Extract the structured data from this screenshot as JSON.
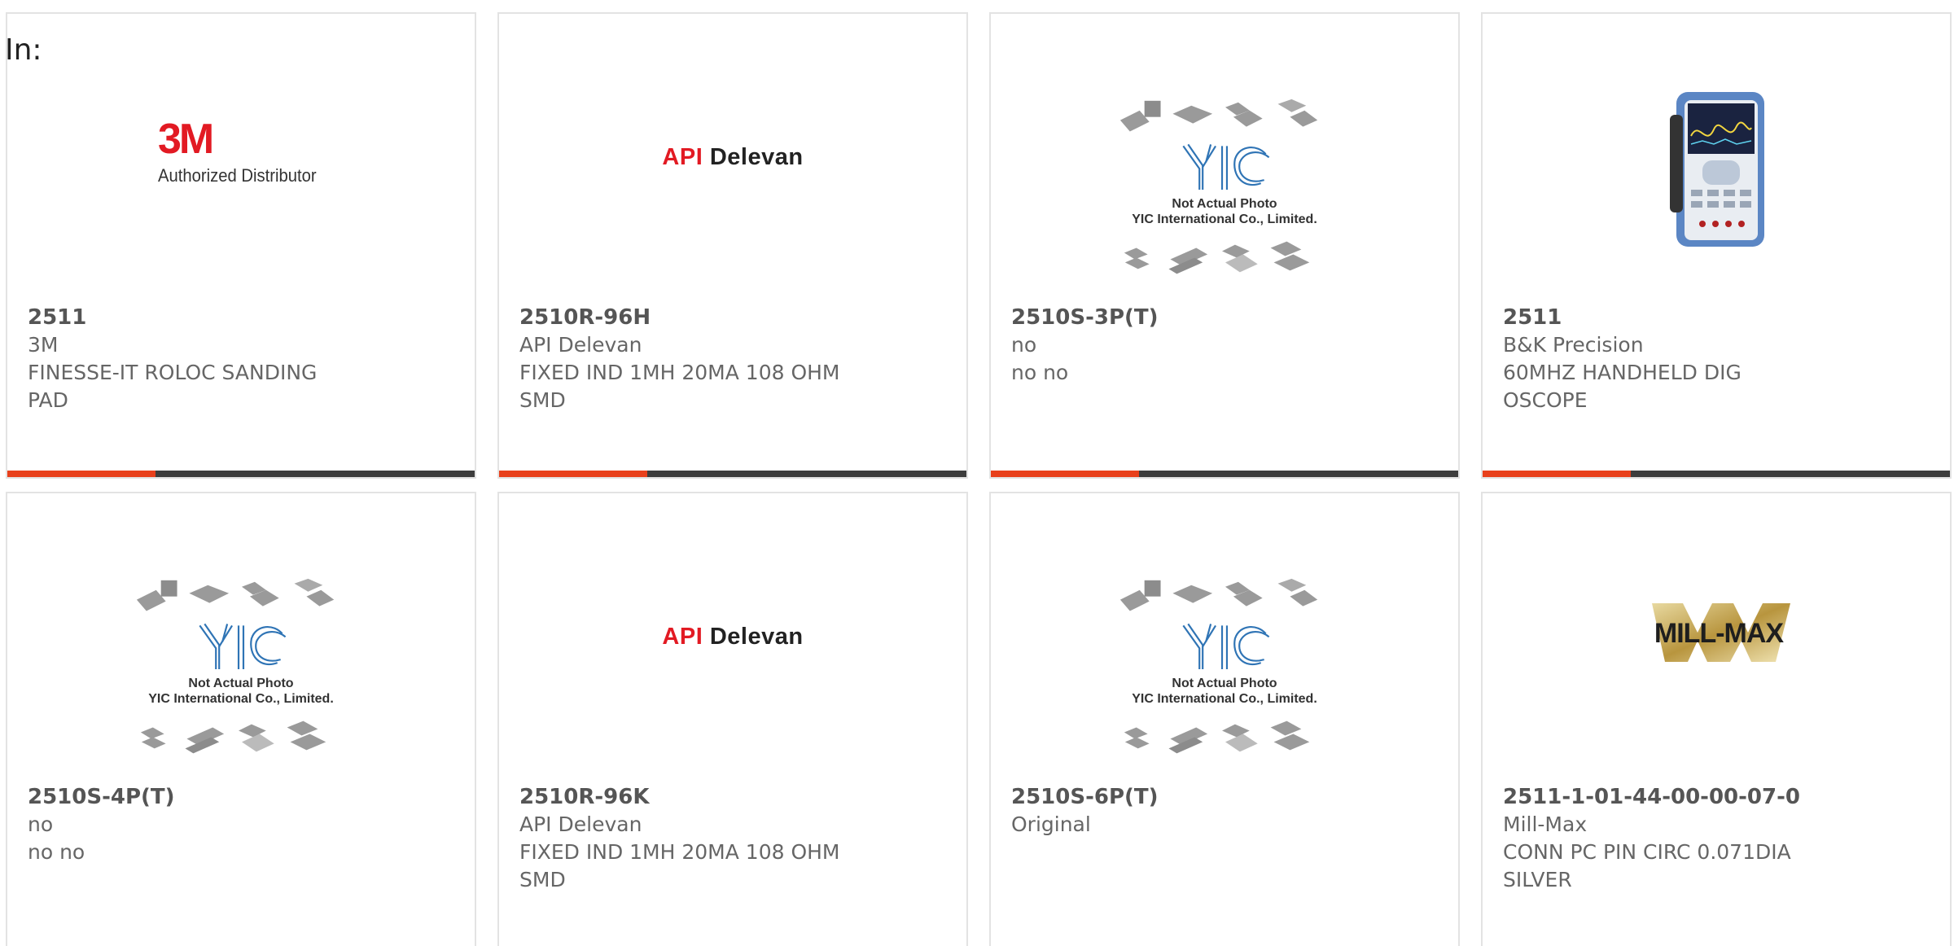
{
  "header": {
    "in_label": "In:"
  },
  "colors": {
    "accent": "#e8401c",
    "bar": "#3d3d3d",
    "border": "#e3e3e3",
    "text": "#666666"
  },
  "products": [
    {
      "image": "3m-authorized-distributor-logo",
      "logo_mark": "3M",
      "logo_sub": "Authorized Distributor",
      "part_number": "2511",
      "manufacturer": "3M",
      "description": "FINESSE-IT ROLOC SANDING PAD"
    },
    {
      "image": "api-delevan-logo",
      "logo_a": "API",
      "logo_b": "Delevan",
      "part_number": "2510R-96H",
      "manufacturer": "API Delevan",
      "description": "FIXED IND 1MH 20MA 108 OHM SMD"
    },
    {
      "image": "yic-not-actual-photo",
      "cap1": "Not Actual Photo",
      "cap2": "YIC International Co., Limited.",
      "part_number": "2510S-3P(T)",
      "manufacturer": "no",
      "description": "no no"
    },
    {
      "image": "handheld-oscilloscope-photo",
      "part_number": "2511",
      "manufacturer": "B&K Precision",
      "description": "60MHZ HANDHELD DIG OSCOPE"
    },
    {
      "image": "yic-not-actual-photo",
      "cap1": "Not Actual Photo",
      "cap2": "YIC International Co., Limited.",
      "part_number": "2510S-4P(T)",
      "manufacturer": "no",
      "description": "no no"
    },
    {
      "image": "api-delevan-logo",
      "logo_a": "API",
      "logo_b": "Delevan",
      "part_number": "2510R-96K",
      "manufacturer": "API Delevan",
      "description": "FIXED IND 1MH 20MA 108 OHM SMD"
    },
    {
      "image": "yic-not-actual-photo",
      "cap1": "Not Actual Photo",
      "cap2": "YIC International Co., Limited.",
      "part_number": "2510S-6P(T)",
      "manufacturer": "Original",
      "description": ""
    },
    {
      "image": "mill-max-logo",
      "logo_text": "MILL-MAX",
      "part_number": "2511-1-01-44-00-00-07-0",
      "manufacturer": "Mill-Max",
      "description": "CONN PC PIN CIRC 0.071DIA SILVER"
    }
  ]
}
